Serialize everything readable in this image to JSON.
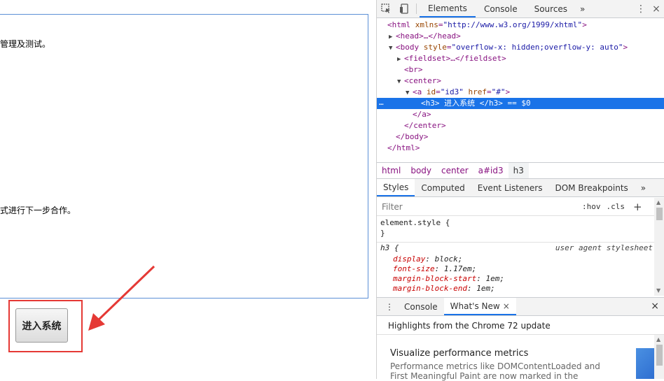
{
  "page": {
    "line1": "管理及测试。",
    "line2": "式进行下一步合作。",
    "enter_button": "进入系统"
  },
  "devtools": {
    "tabs": [
      "Elements",
      "Console",
      "Sources"
    ],
    "more": "»",
    "dom": {
      "l1_tag": "<html ",
      "l1_attr": "xmlns",
      "l1_val": "\"http://www.w3.org/1999/xhtml\"",
      "l1_end": ">",
      "l2": "<head>…</head>",
      "l3_tag": "<body ",
      "l3_attr": "style",
      "l3_val": "\"overflow-x: hidden;overflow-y: auto\"",
      "l3_end": ">",
      "l4": "<fieldset>…</fieldset>",
      "l5": "<br>",
      "l6": "<center>",
      "l7_tag": "<a ",
      "l7_attr1": "id",
      "l7_val1": "\"id3\"",
      "l7_attr2": " href",
      "l7_val2": "\"#\"",
      "l7_end": ">",
      "l8": "<h3>  进入系统 </h3> == $0",
      "l9": "</a>",
      "l10": "</center>",
      "l11": "</body>",
      "l12": "</html>",
      "dots": "…"
    },
    "breadcrumbs": [
      "html",
      "body",
      "center",
      "a#id3",
      "h3"
    ],
    "subtabs": [
      "Styles",
      "Computed",
      "Event Listeners",
      "DOM Breakpoints"
    ],
    "filter_placeholder": "Filter",
    "hov": ":hov",
    "cls": ".cls",
    "plus": "+",
    "styles": {
      "element_style": "element.style {",
      "close1": "}",
      "h3_selector": "h3 {",
      "ua_label": "user agent stylesheet",
      "props": [
        {
          "name": "display",
          "value": "block;"
        },
        {
          "name": "font-size",
          "value": "1.17em;"
        },
        {
          "name": "margin-block-start",
          "value": "1em;"
        },
        {
          "name": "margin-block-end",
          "value": "1em;"
        }
      ]
    },
    "drawer_tabs": [
      "Console",
      "What's New"
    ],
    "close_x": "×",
    "highlights": "Highlights from the Chrome 72 update",
    "card_title": "Visualize performance metrics",
    "card_text": "Performance metrics like DOMContentLoaded and First Meaningful Paint are now marked in the"
  },
  "colors": {
    "accent": "#1a73e8",
    "highlight_red": "#e53935"
  }
}
